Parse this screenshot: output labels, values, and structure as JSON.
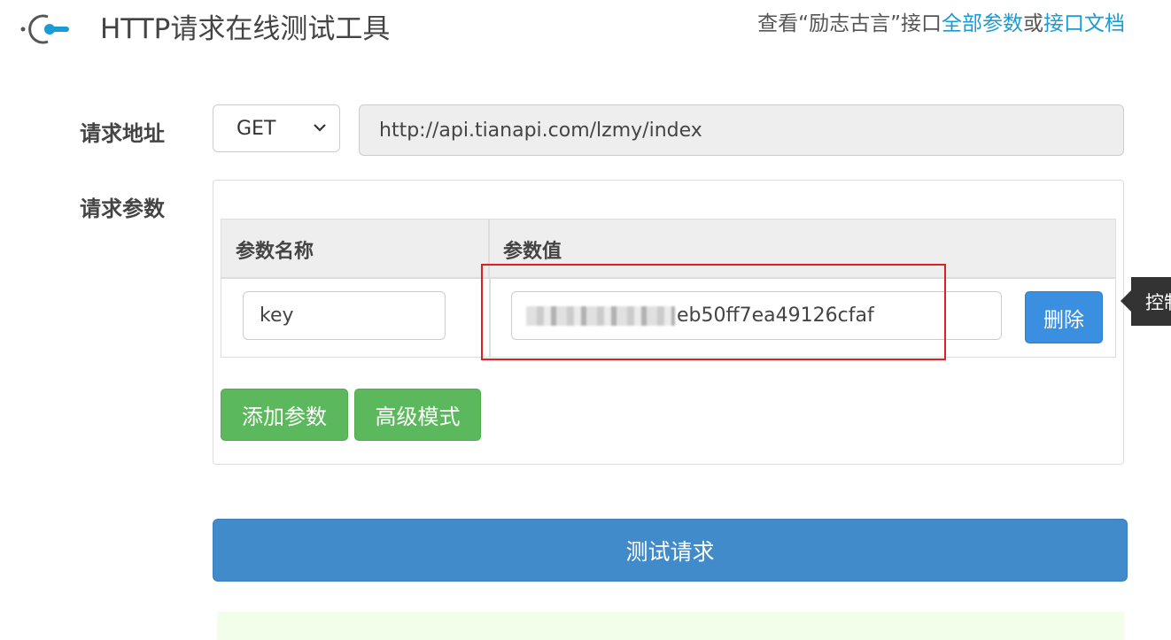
{
  "header": {
    "title": "HTTP请求在线测试工具",
    "links_prefix": "查看“励志古言”接口",
    "link_all_params": "全部参数",
    "links_or": "或",
    "link_api_docs": "接口文档",
    "logo_icon": "plug-icon"
  },
  "request": {
    "address_label": "请求地址",
    "method": "GET",
    "url": "http://api.tianapi.com/lzmy/index"
  },
  "params": {
    "label": "请求参数",
    "col_name": "参数名称",
    "col_value": "参数值",
    "rows": [
      {
        "name": "key",
        "value_visible": "eb50ff7ea49126cfaf",
        "delete_label": "删除"
      }
    ],
    "add_label": "添加参数",
    "advanced_label": "高级模式",
    "tooltip": "控制"
  },
  "submit_label": "测试请求",
  "colors": {
    "primary": "#428bca",
    "success": "#5cb85c",
    "link": "#1a9bd6",
    "highlight": "#e02020"
  }
}
